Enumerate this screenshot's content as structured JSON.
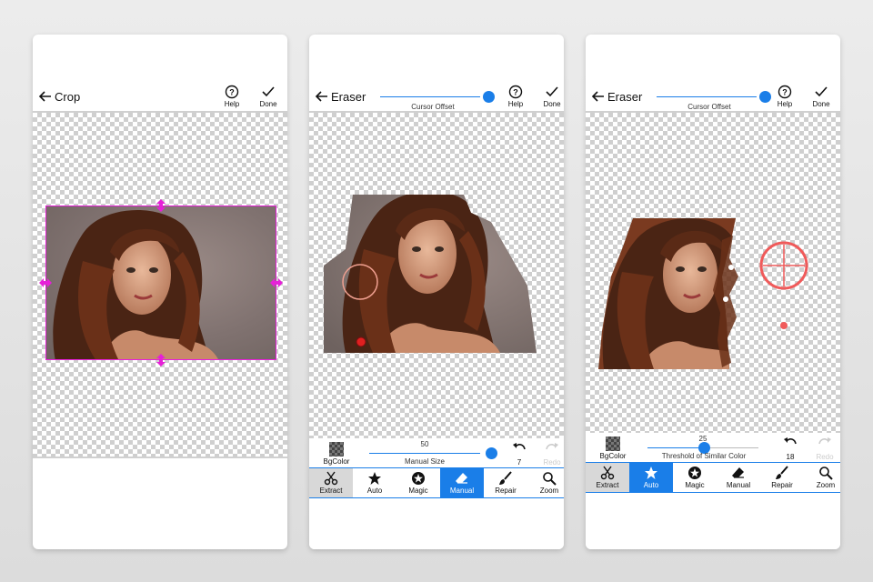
{
  "crop_screen": {
    "title": "Crop",
    "help_label": "Help",
    "done_label": "Done"
  },
  "eraser_screen": {
    "title": "Eraser",
    "offset_label": "Cursor Offset",
    "help_label": "Help",
    "done_label": "Done",
    "bgcolor_label": "BgColor",
    "size_value": "50",
    "size_label": "Manual Size",
    "undo_count": "7",
    "redo_label": "Redo",
    "tools": [
      "Extract",
      "Auto",
      "Magic",
      "Manual",
      "Repair",
      "Zoom"
    ],
    "active_tool": "Manual"
  },
  "auto_screen": {
    "title": "Eraser",
    "offset_label": "Cursor Offset",
    "help_label": "Help",
    "done_label": "Done",
    "bgcolor_label": "BgColor",
    "threshold_value": "25",
    "threshold_label": "Threshold of Similar Color",
    "undo_count": "18",
    "redo_label": "Redo",
    "tools": [
      "Extract",
      "Auto",
      "Magic",
      "Manual",
      "Repair",
      "Zoom"
    ],
    "active_tool": "Auto"
  },
  "colors": {
    "accent": "#1a7ee8",
    "crop_handle": "#e620d8",
    "target_ring": "#f05a5a"
  }
}
